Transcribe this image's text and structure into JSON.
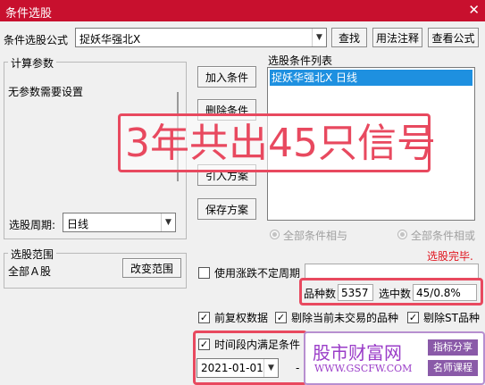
{
  "window": {
    "title": "条件选股",
    "close_glyph": "✕"
  },
  "formula": {
    "label": "条件选股公式",
    "value": "捉妖华强北X",
    "buttons": {
      "find": "查找",
      "usage": "用法注释",
      "view": "查看公式"
    }
  },
  "params": {
    "title": "计算参数",
    "message": "无参数需要设置",
    "period_label": "选股周期:",
    "period_value": "日线"
  },
  "actions": {
    "add": "加入条件",
    "delete": "删除条件",
    "import": "引入方案",
    "save": "保存方案"
  },
  "conditions": {
    "title": "选股条件列表",
    "items": [
      "捉妖华强北X  日线"
    ],
    "radio_and": "全部条件相与",
    "radio_or": "全部条件相或"
  },
  "scope": {
    "title": "选股范围",
    "value": "全部Ａ股",
    "change_button": "改变范围"
  },
  "status": {
    "done": "选股完毕.",
    "count_label": "品种数",
    "count_value": "5357",
    "selected_label": "选中数",
    "selected_value": "45/0.8%"
  },
  "options": {
    "unfixed_period": "使用涨跌不定周期",
    "adjusted": "前复权数据",
    "exclude_untraded": "剔除当前未交易的品种",
    "exclude_st": "剔除ST品种",
    "time_range": "时间段内满足条件",
    "date_from": "2021-01-01",
    "date_separator": "-"
  },
  "annotation": {
    "text": "3年共出45只信号"
  },
  "watermark": {
    "brand": "股市财富网",
    "url": "WWW.GSCFW.COM",
    "tag1": "指标分享",
    "tag2": "名师课程"
  },
  "colors": {
    "title_bar": "#c8102e",
    "selection": "#1e90e0",
    "highlight": "#e8495f",
    "status_red": "#e0141e"
  }
}
